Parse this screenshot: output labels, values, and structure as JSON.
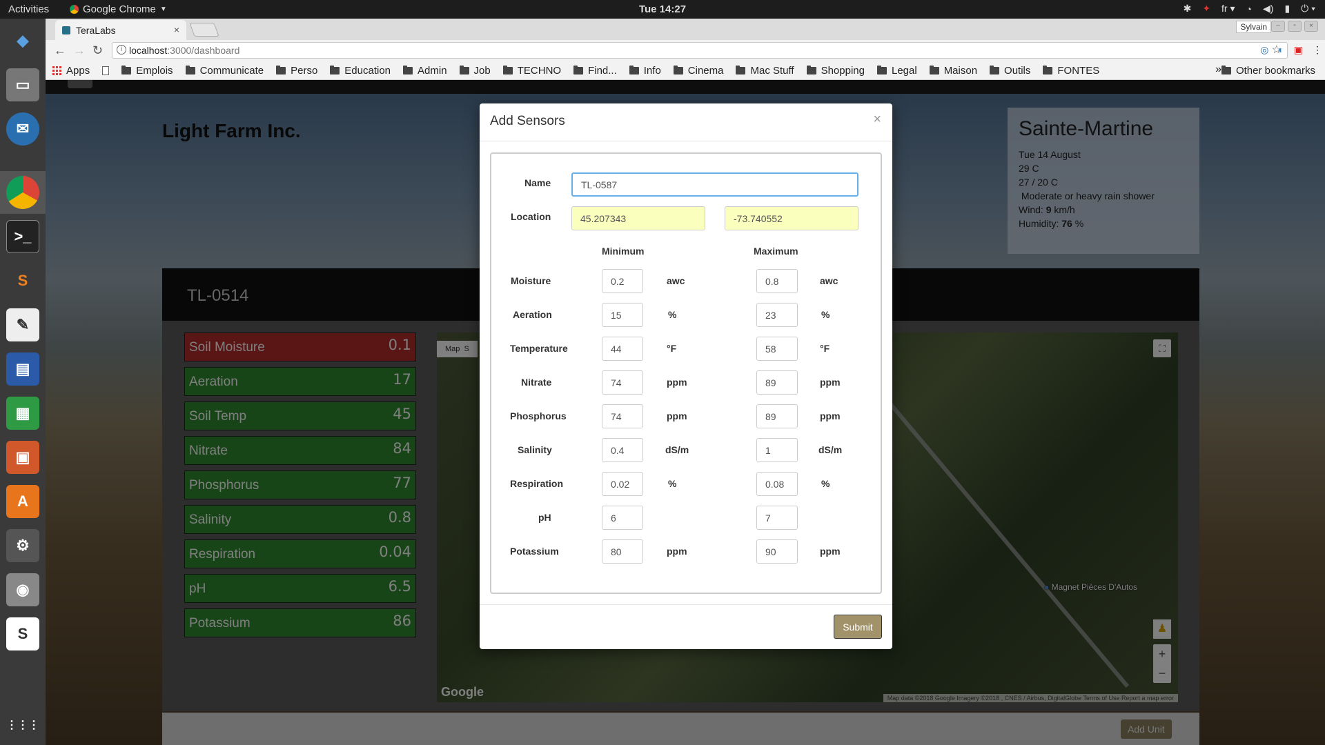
{
  "topbar": {
    "activities": "Activities",
    "app_name": "Google Chrome",
    "clock": "Tue 14:27",
    "language": "fr"
  },
  "chrome": {
    "tab_title": "TeraLabs",
    "tab_close": "×",
    "user": "Sylvain",
    "url_host": "localhost",
    "url_rest": ":3000/dashboard",
    "bookmarks": [
      "Apps",
      "Emplois",
      "Communicate",
      "Perso",
      "Education",
      "Admin",
      "Job",
      "TECHNO",
      "Find...",
      "Info",
      "Cinema",
      "Mac Stuff",
      "Shopping",
      "Legal",
      "Maison",
      "Outils",
      "FONTES"
    ],
    "more": "»",
    "other_bookmarks": "Other bookmarks"
  },
  "page": {
    "company": "Light Farm Inc.",
    "weather": {
      "city": "Sainte-Martine",
      "date": "Tue 14 August",
      "temp": "29 C",
      "range": "27 / 20 C",
      "condition": "Moderate or heavy rain shower",
      "wind_label": "Wind: ",
      "wind_value": "9",
      "wind_unit": " km/h",
      "humidity_label": "Humidity: ",
      "humidity_value": "76",
      "humidity_unit": " %"
    },
    "unit_title": "TL-0514",
    "sensors": [
      {
        "label": "Soil Moisture",
        "value": "0.1",
        "status": "alert"
      },
      {
        "label": "Aeration",
        "value": "17",
        "status": "ok"
      },
      {
        "label": "Soil Temp",
        "value": "45",
        "status": "ok"
      },
      {
        "label": "Nitrate",
        "value": "84",
        "status": "ok"
      },
      {
        "label": "Phosphorus",
        "value": "77",
        "status": "ok"
      },
      {
        "label": "Salinity",
        "value": "0.8",
        "status": "ok"
      },
      {
        "label": "Respiration",
        "value": "0.04",
        "status": "ok"
      },
      {
        "label": "pH",
        "value": "6.5",
        "status": "ok"
      },
      {
        "label": "Potassium",
        "value": "86",
        "status": "ok"
      }
    ],
    "map": {
      "map_type": "Map",
      "map_type_2": "S",
      "poi": "Magnet Pièces D'Autos",
      "google": "Google",
      "attribution": "Map data ©2018 Google Imagery ©2018 , CNES / Airbus, DigitalGlobe   Terms of Use   Report a map error"
    },
    "add_unit": "Add Unit"
  },
  "modal": {
    "title": "Add Sensors",
    "close": "×",
    "name_label": "Name",
    "name_value": "TL-0587",
    "location_label": "Location",
    "latitude": "45.207343",
    "longitude": "-73.740552",
    "min_header": "Minimum",
    "max_header": "Maximum",
    "rows": [
      {
        "label": "Moisture",
        "min": "0.2",
        "max": "0.8",
        "unit": "awc"
      },
      {
        "label": "Aeration",
        "min": "15",
        "max": "23",
        "unit": "%"
      },
      {
        "label": "Temperature",
        "min": "44",
        "max": "58",
        "unit": "°F"
      },
      {
        "label": "Nitrate",
        "min": "74",
        "max": "89",
        "unit": "ppm"
      },
      {
        "label": "Phosphorus",
        "min": "74",
        "max": "89",
        "unit": "ppm"
      },
      {
        "label": "Salinity",
        "min": "0.4",
        "max": "1",
        "unit": "dS/m"
      },
      {
        "label": "Respiration",
        "min": "0.02",
        "max": "0.08",
        "unit": "%"
      },
      {
        "label": "pH",
        "min": "6",
        "max": "7",
        "unit": ""
      },
      {
        "label": "Potassium",
        "min": "80",
        "max": "90",
        "unit": "ppm"
      }
    ],
    "submit": "Submit"
  },
  "colors": {
    "sensor_ok": "#2e8a2e",
    "sensor_alert": "#b52a2a",
    "submit_bg": "#a19269",
    "autofill": "#faffbd"
  }
}
